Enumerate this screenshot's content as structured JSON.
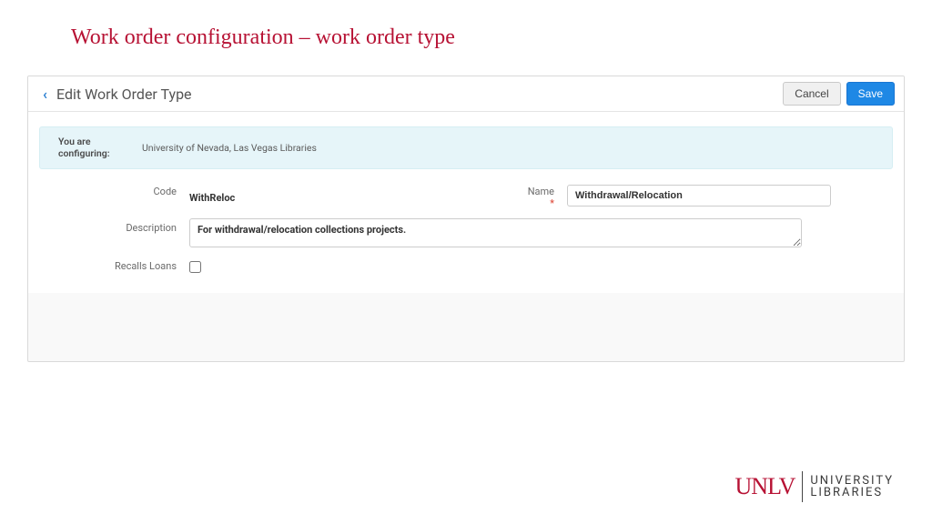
{
  "slide": {
    "title": "Work order configuration – work order type"
  },
  "panel": {
    "title": "Edit Work Order Type",
    "cancel_label": "Cancel",
    "save_label": "Save"
  },
  "context": {
    "label": "You are configuring:",
    "value": "University of Nevada, Las Vegas Libraries"
  },
  "form": {
    "code_label": "Code",
    "code_value": "WithReloc",
    "name_label": "Name",
    "name_value": "Withdrawal/Relocation",
    "description_label": "Description",
    "description_value": "For withdrawal/relocation collections projects.",
    "recalls_label": "Recalls Loans",
    "recalls_checked": false
  },
  "footer": {
    "mark": "UNLV",
    "line1": "UNIVERSITY",
    "line2": "LIBRARIES"
  }
}
